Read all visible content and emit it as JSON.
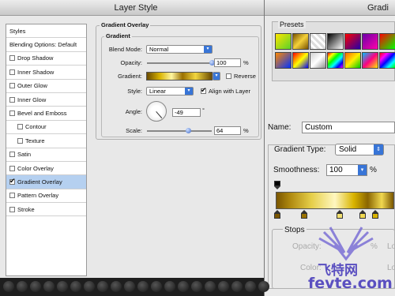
{
  "layer_style": {
    "title": "Layer Style",
    "sidebar": {
      "header": "Styles",
      "blending": "Blending Options: Default",
      "items": [
        {
          "label": "Drop Shadow",
          "checked": false,
          "sub": false,
          "selected": false
        },
        {
          "label": "Inner Shadow",
          "checked": false,
          "sub": false,
          "selected": false
        },
        {
          "label": "Outer Glow",
          "checked": false,
          "sub": false,
          "selected": false
        },
        {
          "label": "Inner Glow",
          "checked": false,
          "sub": false,
          "selected": false
        },
        {
          "label": "Bevel and Emboss",
          "checked": false,
          "sub": false,
          "selected": false
        },
        {
          "label": "Contour",
          "checked": false,
          "sub": true,
          "selected": false
        },
        {
          "label": "Texture",
          "checked": false,
          "sub": true,
          "selected": false
        },
        {
          "label": "Satin",
          "checked": false,
          "sub": false,
          "selected": false
        },
        {
          "label": "Color Overlay",
          "checked": false,
          "sub": false,
          "selected": false
        },
        {
          "label": "Gradient Overlay",
          "checked": true,
          "sub": false,
          "selected": true
        },
        {
          "label": "Pattern Overlay",
          "checked": false,
          "sub": false,
          "selected": false
        },
        {
          "label": "Stroke",
          "checked": false,
          "sub": false,
          "selected": false
        }
      ]
    },
    "panel": {
      "section_title": "Gradient Overlay",
      "group_title": "Gradient",
      "blend_mode_label": "Blend Mode:",
      "blend_mode_value": "Normal",
      "opacity_label": "Opacity:",
      "opacity_value": "100",
      "opacity_percent": 100,
      "opacity_unit": "%",
      "gradient_label": "Gradient:",
      "reverse_label": "Reverse",
      "style_label": "Style:",
      "style_value": "Linear",
      "align_label": "Align with Layer",
      "angle_label": "Angle:",
      "angle_value": "-49",
      "angle_unit": "°",
      "scale_label": "Scale:",
      "scale_value": "64",
      "scale_percent": 64,
      "scale_unit": "%"
    }
  },
  "gradient_editor": {
    "title": "Gradi",
    "presets_label": "Presets",
    "preset_gradients": [
      "linear-gradient(135deg,#ffe600,#5ad12a)",
      "linear-gradient(135deg,#7a5200,#f4d13a,#7a5200)",
      "repeating-linear-gradient(45deg,#ddd 0 3px,#fff 3px 6px)",
      "linear-gradient(135deg,#000,#fff)",
      "linear-gradient(135deg,#ff0000,#2200aa)",
      "linear-gradient(135deg,#6a00aa,#ff00aa)",
      "linear-gradient(135deg,#ff0000,#00ff00)",
      "linear-gradient(135deg,#ff8800,#0033ff)",
      "linear-gradient(135deg,#ff0000,#ffff00,#0000ff)",
      "linear-gradient(135deg,#d0d0d0,#fff,#909090)",
      "linear-gradient(135deg,#ff0000,#ffff00,#00ff00,#00ffff,#0000ff,#ff00ff)",
      "linear-gradient(135deg,#ff6600,#ffee00,#00cc00)",
      "linear-gradient(135deg,#00c0ff,#ff0080,#ffee00)",
      "linear-gradient(135deg,#ff0000,#ff00ff,#0000ff,#00ffff,#00ff00)"
    ],
    "name_label": "Name:",
    "name_value": "Custom",
    "type_label": "Gradient Type:",
    "type_value": "Solid",
    "smoothness_label": "Smoothness:",
    "smoothness_value": "100",
    "smoothness_unit": "%",
    "stops_label": "Stops",
    "opacity_label": "Opacity:",
    "color_label": "Color:",
    "percent_label": "%",
    "location_short": "Lo"
  },
  "watermark": {
    "text_cn": "飞特网",
    "text_en": "fevte.com"
  },
  "colors": {
    "selected_row": "#b5d0f0",
    "accent": "#3875d7"
  }
}
